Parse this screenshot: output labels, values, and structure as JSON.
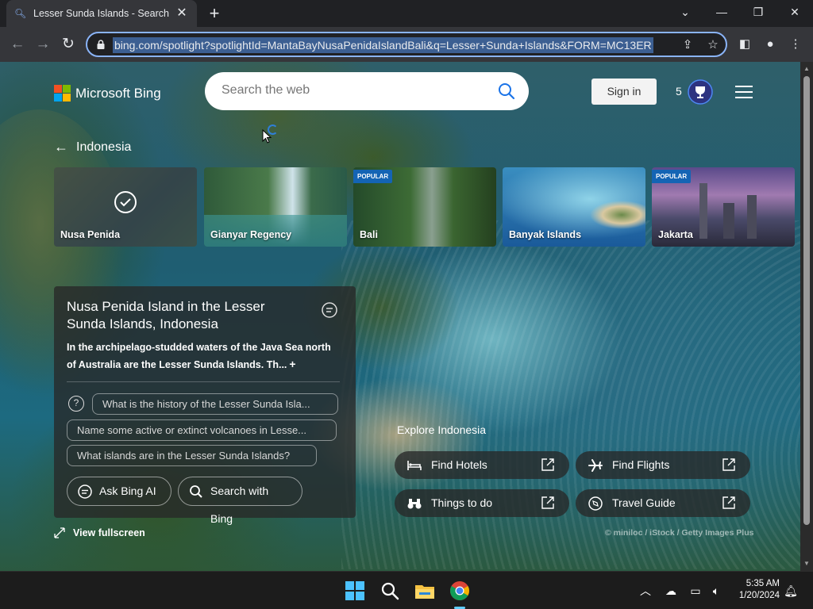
{
  "browser": {
    "tab_title": "Lesser Sunda Islands - Search",
    "url": "bing.com/spotlight?spotlightId=MantaBayNusaPenidaIslandBali&q=Lesser+Sunda+Islands&FORM=MC13ER"
  },
  "bing": {
    "brand": "Microsoft Bing",
    "search_placeholder": "Search the web",
    "sign_in": "Sign in",
    "points": "5"
  },
  "spotlight": {
    "back_label": "Indonesia",
    "cards": [
      {
        "label": "Nusa Penida",
        "badge": "",
        "selected": true
      },
      {
        "label": "Gianyar Regency",
        "badge": ""
      },
      {
        "label": "Bali",
        "badge": "POPULAR"
      },
      {
        "label": "Banyak Islands",
        "badge": ""
      },
      {
        "label": "Jakarta",
        "badge": "POPULAR"
      }
    ],
    "info": {
      "title": "Nusa Penida Island in the Lesser Sunda Islands, Indonesia",
      "description": "In the archipelago-studded waters of the Java Sea north of Australia are the Lesser Sunda Islands. Th...",
      "questions": [
        "What is the history of the Lesser Sunda Isla...",
        "Name some active or extinct volcanoes in Lesse...",
        "What islands are in the Lesser Sunda Islands?"
      ],
      "ask_ai": "Ask Bing AI",
      "search_with": "Search with Bing"
    },
    "view_fullscreen": "View fullscreen",
    "explore_title": "Explore Indonesia",
    "explore_links": [
      "Find Hotels",
      "Find Flights",
      "Things to do",
      "Travel Guide"
    ],
    "credit": "© miniloc / iStock / Getty Images Plus"
  },
  "taskbar": {
    "time": "5:35 AM",
    "date": "1/20/2024"
  },
  "colors": {
    "accent": "#8ab4f8",
    "popular_badge": "#1464b4",
    "ms_red": "#f25022",
    "ms_green": "#7fba00",
    "ms_blue": "#00a4ef",
    "ms_yellow": "#ffb900"
  }
}
